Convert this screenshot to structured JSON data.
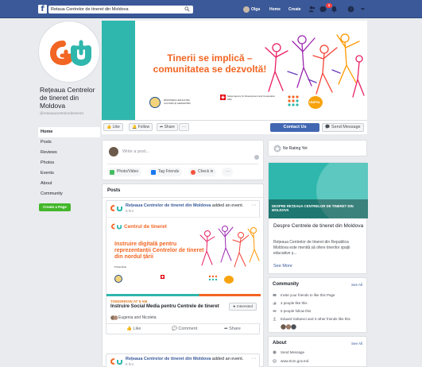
{
  "topbar": {
    "search_value": "Retaua Centrelor de tineret din Moldova",
    "profile_name": "Olga",
    "home_label": "Home",
    "create_label": "Create",
    "notif_count": "1"
  },
  "page": {
    "name": "Rețeaua Centrelor de tineret din Moldova",
    "handle": "@reteauacentrelordetineret",
    "nav": [
      "Home",
      "Posts",
      "Reviews",
      "Photos",
      "Events",
      "About",
      "Community"
    ],
    "create_page_label": "Create a Page"
  },
  "cover": {
    "headline": "Tinerii se implică – comunitatea se dezvoltă!",
    "ministry_text": "MINISTERUL EDUCAȚIEI, CULTURII ȘI CERCETĂRII",
    "swiss_text": "Swiss Agency for Development and Cooperation SDC",
    "unfpa_label": "UNFPA"
  },
  "actions": {
    "like": "Like",
    "follow": "Follow",
    "share": "Share",
    "more": "···",
    "contact": "Contact Us",
    "send_message": "Send Message"
  },
  "composer": {
    "placeholder": "Write a post...",
    "photo_video": "Photo/Video",
    "tag_friends": "Tag Friends",
    "check_in": "Check in",
    "more": "···"
  },
  "posts": {
    "header": "Posts",
    "post1": {
      "author": "Rețeaua Centrelor de tineret din Moldova",
      "action": " added an event.",
      "time": "6 hrs",
      "image_brand": "Centrul de tineret",
      "image_title": "Instruire digitală pentru reprezentanții Centrelor de tineret din nordul țării",
      "image_date": "8 Noiembrie",
      "event_when": "TOMORROW AT 9 AM",
      "event_name": "Instruire Social Media pentru Centrele de tineret",
      "interested": "★ Interested",
      "going": "Eugenia and Nicoleta",
      "like": "Like",
      "comment": "Comment",
      "share": "Share"
    },
    "post2": {
      "author": "Rețeaua Centrelor de tineret din Moldova",
      "action": " added an event.",
      "time": "6 hrs"
    }
  },
  "sidebar": {
    "rating": "No Rating Yet",
    "about_image_caption": "DESPRE REȚEAUA CENTRELOR DE TINERET DIN MOLDOVA",
    "about_title": "Despre Centrele de tineret din Moldova",
    "about_desc": "Rețeaua Centrelor de tineret din Republica Moldova este menită să ofere tinerilor spații educative ș...",
    "see_more": "See More",
    "community_header": "Community",
    "see_all": "See All",
    "community_rows": [
      "Invite your friends to like this Page",
      "4 people like this",
      "5 people follow this",
      "Eduard Soltanici and 3 other friends like this"
    ],
    "about_header": "About",
    "about_rows": [
      "Send Message",
      "www.rtcm.gov.md"
    ]
  },
  "colors": {
    "brand_blue": "#3b5998",
    "accent_orange": "#f26522",
    "accent_teal": "#2fb7ad",
    "button_blue": "#4267b2"
  }
}
